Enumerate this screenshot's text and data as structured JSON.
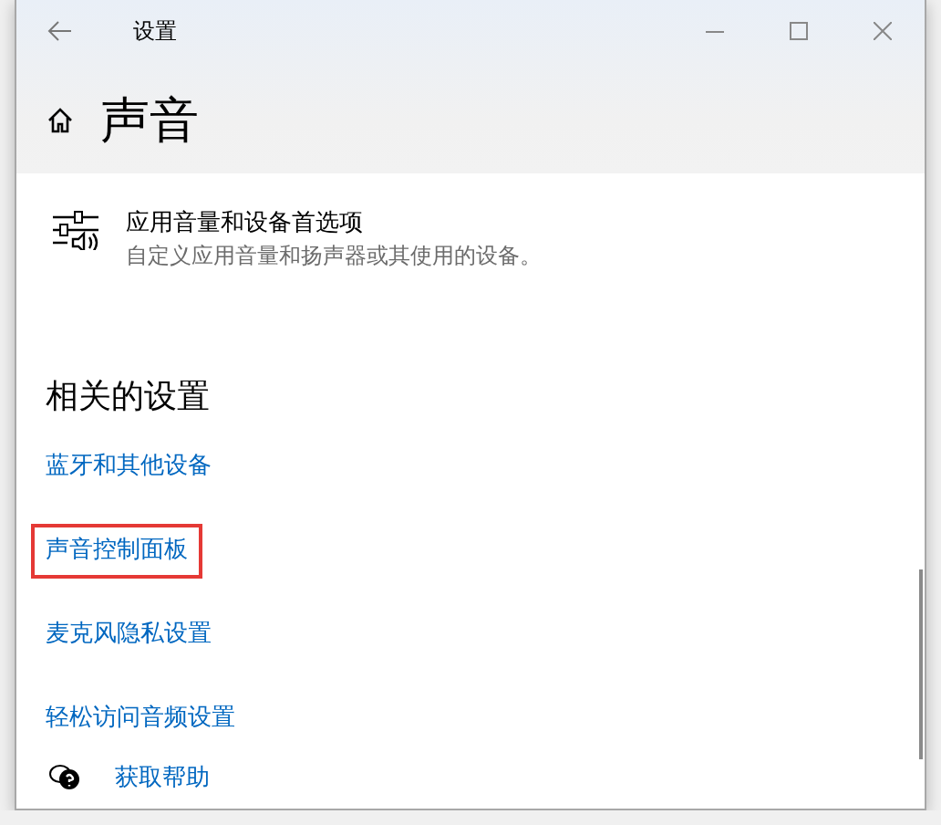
{
  "window": {
    "title": "设置"
  },
  "page": {
    "heading": "声音"
  },
  "option": {
    "title": "应用音量和设备首选项",
    "description": "自定义应用音量和扬声器或其使用的设备。"
  },
  "related": {
    "heading": "相关的设置",
    "links": [
      {
        "label": "蓝牙和其他设备",
        "highlighted": false
      },
      {
        "label": "声音控制面板",
        "highlighted": true
      },
      {
        "label": "麦克风隐私设置",
        "highlighted": false
      },
      {
        "label": "轻松访问音频设置",
        "highlighted": false
      }
    ]
  },
  "help": {
    "label": "获取帮助"
  }
}
